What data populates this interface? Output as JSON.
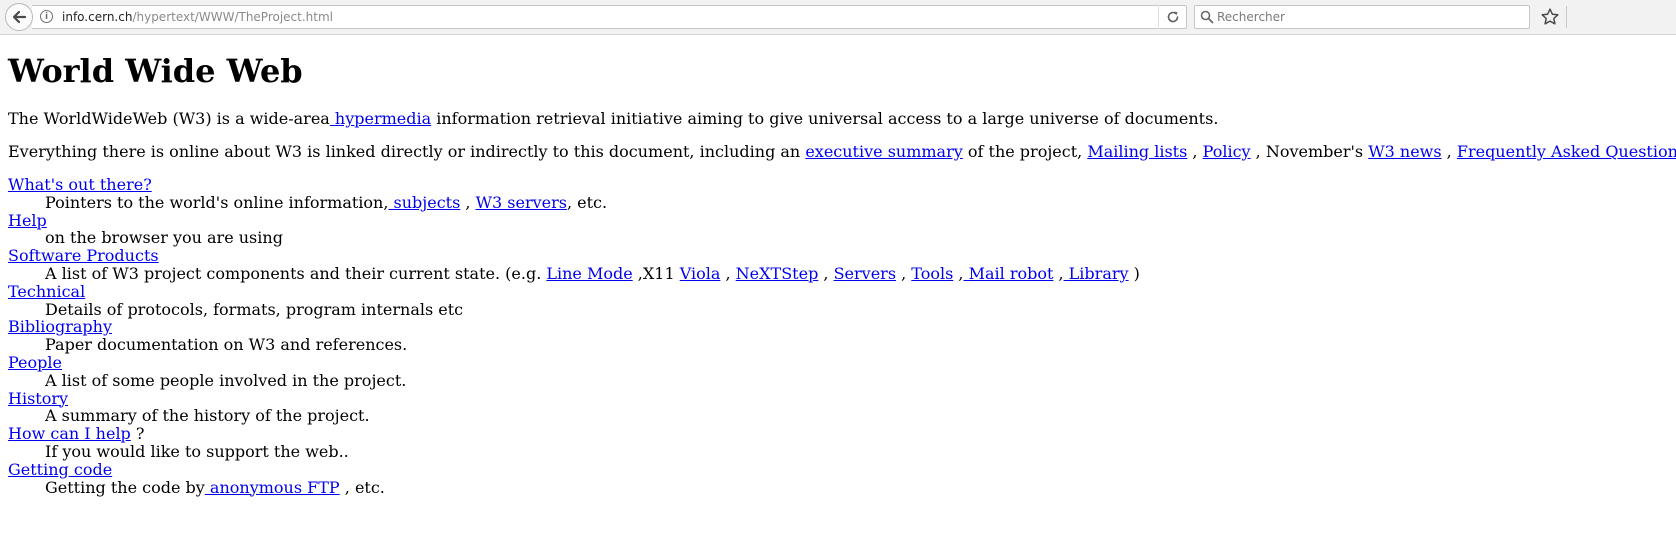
{
  "browser": {
    "url_host": "info.cern.ch",
    "url_path": "/hypertext/WWW/TheProject.html",
    "search_placeholder": "Rechercher"
  },
  "page": {
    "title": "World Wide Web",
    "intro": {
      "before": "The WorldWideWeb (W3) is a wide-area",
      "link": " hypermedia",
      "after": " information retrieval initiative aiming to give universal access to a large universe of documents."
    },
    "summary": {
      "t1": "Everything there is online about W3 is linked directly or indirectly to this document, including an ",
      "l1": "executive summary",
      "t2": " of the project, ",
      "l2": "Mailing lists",
      "t3": " , ",
      "l3": "Policy",
      "t4": " , November's ",
      "l4": "W3 news",
      "t5": " , ",
      "l5": "Frequently Asked Questions",
      "t6": " ."
    },
    "entries": {
      "whats_out": {
        "term": "What's out there?",
        "d1": "Pointers to the world's online information,",
        "l1": " subjects",
        "d2": " , ",
        "l2": "W3 servers",
        "d3": ", etc."
      },
      "help": {
        "term": "Help",
        "desc": "on the browser you are using"
      },
      "software": {
        "term": "Software Products",
        "d1": "A list of W3 project components and their current state. (e.g. ",
        "l_line_mode": "Line Mode",
        "d2": " ,X11 ",
        "l_viola": "Viola",
        "d3": " , ",
        "l_nextstep": "NeXTStep",
        "d4": " , ",
        "l_servers": "Servers",
        "d5": " , ",
        "l_tools": "Tools",
        "d6": " ,",
        "l_mail_robot": " Mail robot",
        "d7": " ,",
        "l_library": " Library",
        "d8": " )"
      },
      "technical": {
        "term": "Technical",
        "desc": "Details of protocols, formats, program internals etc"
      },
      "bibliography": {
        "term": "Bibliography",
        "desc": "Paper documentation on W3 and references."
      },
      "people": {
        "term": "People",
        "desc": "A list of some people involved in the project."
      },
      "history": {
        "term": "History",
        "desc": "A summary of the history of the project."
      },
      "how_help": {
        "term": "How can I help",
        "term_after": " ?",
        "desc": "If you would like to support the web.."
      },
      "getting_code": {
        "term": "Getting code",
        "d1": "Getting the code by",
        "l1": " anonymous FTP",
        "d2": " , etc."
      }
    }
  }
}
